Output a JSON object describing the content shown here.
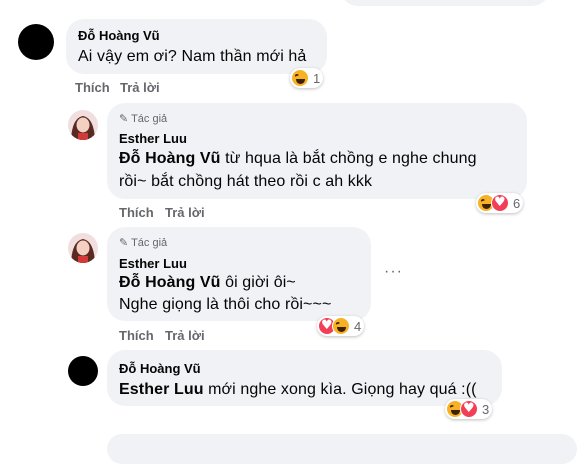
{
  "comments": [
    {
      "author": "Đỗ Hoàng Vũ",
      "text": "Ai vậy em ơi? Nam thần mới hả",
      "reactions": {
        "icons": [
          "haha-icon"
        ],
        "count": "1"
      },
      "actions": {
        "like": "Thích",
        "reply": "Trả lời"
      }
    },
    {
      "badge": "Tác giả",
      "author": "Esther Luu",
      "mention": "Đỗ Hoàng Vũ",
      "line1": " từ hqua là bắt chồng e nghe chung",
      "line2": "rồi~ bắt chồng hát theo rồi c ah kkk",
      "reactions": {
        "icons": [
          "haha-icon",
          "love-icon"
        ],
        "count": "6"
      },
      "actions": {
        "like": "Thích",
        "reply": "Trả lời"
      }
    },
    {
      "badge": "Tác giả",
      "author": "Esther Luu",
      "mention": "Đỗ Hoàng Vũ",
      "line1": " ôi giời ôi~",
      "line2": "Nghe giọng là thôi cho rồi~~~",
      "reactions": {
        "icons": [
          "love-icon",
          "haha-icon"
        ],
        "count": "4"
      },
      "actions": {
        "like": "Thích",
        "reply": "Trả lời"
      },
      "more_label": "···"
    },
    {
      "author": "Đỗ Hoàng Vũ",
      "mention": "Esther Luu",
      "line1": " mới nghe xong kìa. Giọng hay quá :((",
      "reactions": {
        "icons": [
          "haha-icon",
          "love-icon"
        ],
        "count": "3"
      }
    }
  ],
  "colors": {
    "bubble": "#f0f2f5",
    "secondary_text": "#65676b",
    "haha": "#f7b125",
    "love": "#f33e58"
  }
}
